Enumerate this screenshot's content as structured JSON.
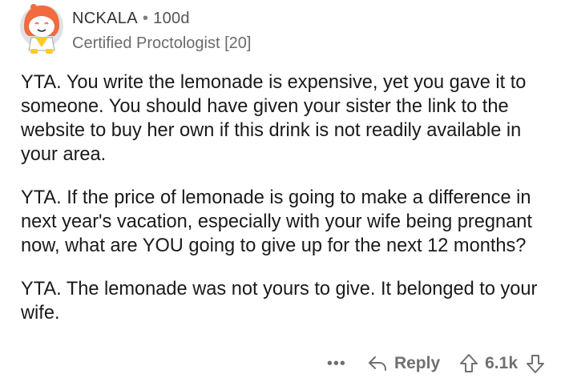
{
  "comment": {
    "username": "NCKALA",
    "separator": "•",
    "age": "100d",
    "flair": "Certified Proctologist [20]",
    "paragraphs": [
      "YTA.  You write the lemonade is expensive, yet you gave it to someone.  You should have given your sister the link to the website to buy her own if this drink is not readily available in your area.",
      "YTA.  If the price of lemonade is going to make a difference in next year's vacation, especially with your wife being pregnant now, what are YOU going to give up for the next 12 months?",
      "YTA.  The lemonade was not yours to give.  It belonged to your wife."
    ],
    "actions": {
      "more_label": "•••",
      "reply_label": "Reply",
      "score": "6.1k"
    }
  },
  "colors": {
    "text": "#1a1a1b",
    "meta": "#707070",
    "avatar_bg": "#cfd8dc",
    "avatar_hood": "#ff7043",
    "avatar_accent": "#ffc107"
  }
}
